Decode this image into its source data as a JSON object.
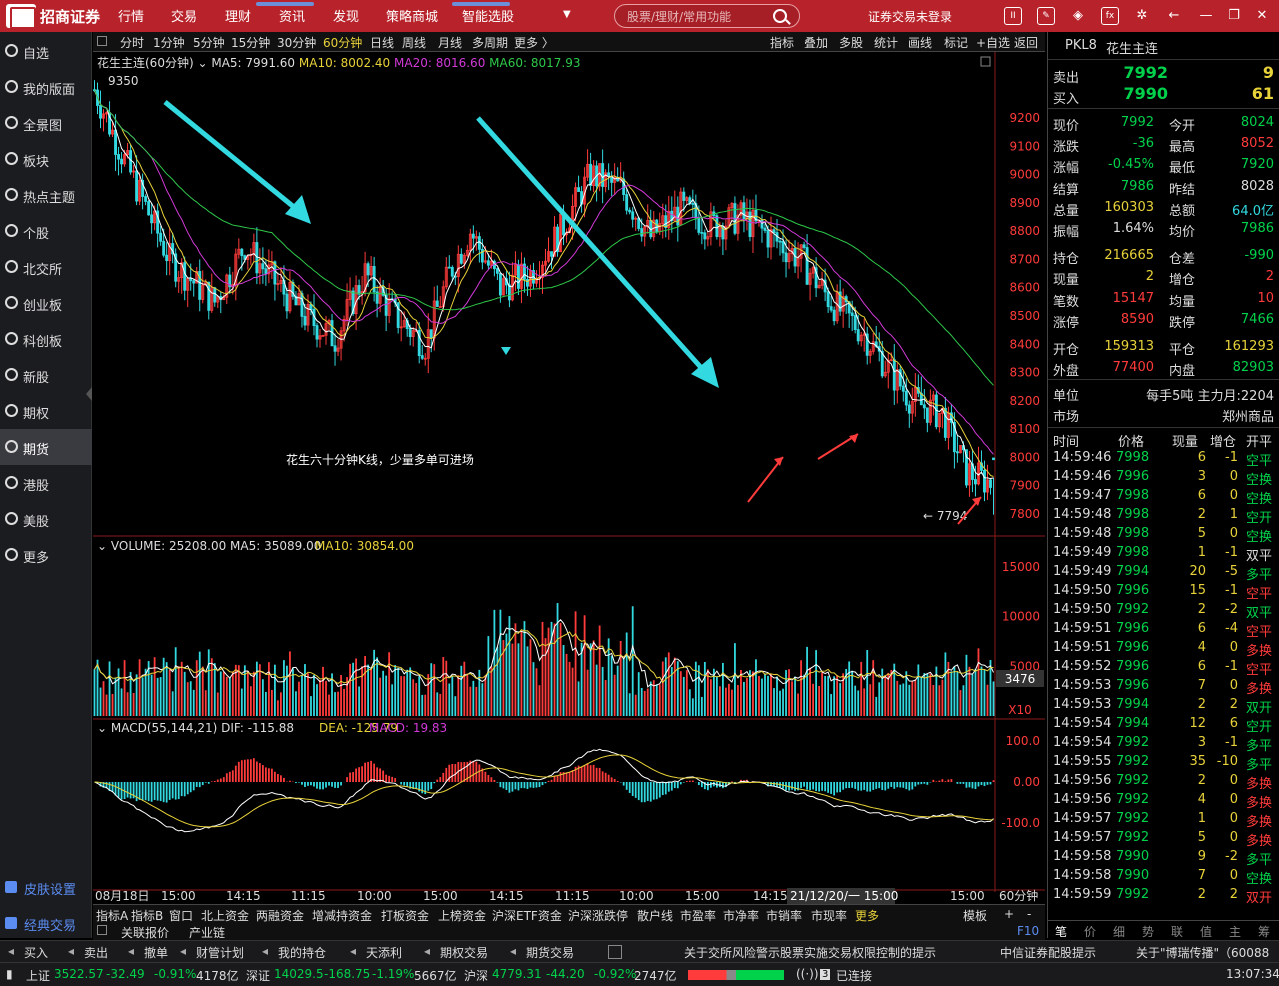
{
  "app": {
    "logo_text": "招商证券",
    "login_status": "证券交易未登录"
  },
  "topnav": [
    "行情",
    "交易",
    "理财",
    "资讯",
    "发现",
    "策略商城",
    "智能选股"
  ],
  "search": {
    "placeholder": "股票/理财/常用功能"
  },
  "top_icons": [
    "trade-icon",
    "edit-icon",
    "cube-icon",
    "fx-icon",
    "gear-icon",
    "back-icon",
    "window-restore-icon",
    "close-icon"
  ],
  "sidebar": [
    "自选",
    "我的版面",
    "全景图",
    "板块",
    "热点主题",
    "个股",
    "北交所",
    "创业板",
    "科创板",
    "新股",
    "期权",
    "期货",
    "港股",
    "美股",
    "更多"
  ],
  "sidebar_active": 11,
  "sidebar_bottom": [
    "皮肤设置",
    "经典交易"
  ],
  "periods": [
    "分时",
    "1分钟",
    "5分钟",
    "15分钟",
    "30分钟",
    "60分钟",
    "日线",
    "周线",
    "月线",
    "多周期",
    "更多 〉"
  ],
  "period_active": 5,
  "chart_tools": [
    "指标",
    "叠加",
    "多股",
    "统计",
    "画线",
    "标记",
    "+自选",
    "返回"
  ],
  "kline": {
    "name": "花生主连(60分钟)",
    "ma5": "MA5: 7991.60",
    "ma10": "MA10: 8002.40",
    "ma20": "MA20: 8016.60",
    "ma60": "MA60: 8017.93",
    "high_mark": "9350",
    "low_mark": "7794",
    "annotation": "花生六十分钟K线，少量多单可进场"
  },
  "volume": {
    "label": "VOLUME: 25208.00",
    "ma5": "MA5: 35089.00",
    "ma10": "MA10: 30854.00",
    "last": "3476",
    "unit": "X10",
    "ticks": [
      "15000",
      "10000",
      "5000"
    ]
  },
  "macd": {
    "label": "MACD(55,144,21)",
    "dif": "DIF: -115.88",
    "dea": "DEA: -125.79",
    "macd": "MACD: 19.83",
    "ticks": [
      "100.0",
      "0.00",
      "-100.0"
    ]
  },
  "time_axis": [
    "08月18日",
    "15:00",
    "14:15",
    "11:15",
    "10:00",
    "15:00",
    "14:15",
    "11:15",
    "10:00",
    "15:00",
    "14:15",
    "15:00",
    "15:00"
  ],
  "time_cursor": "21/12/20/一 15:00",
  "time_unit": "60分钟",
  "bottom_tabs": [
    "指标A",
    "指标B",
    "窗口",
    "北上资金",
    "两融资金",
    "增减持资金",
    "打板资金",
    "上榜资金",
    "沪深ETF资金",
    "沪深涨跌停",
    "散户线",
    "市盈率",
    "市净率",
    "市销率",
    "市现率",
    "更多"
  ],
  "bottom_tabs_right": [
    "模板",
    "+",
    "-"
  ],
  "bottom_tabs2": [
    "关联报价",
    "产业链"
  ],
  "bottom_f10": "F10",
  "chart_data": {
    "type": "candlestick",
    "title": "花生主连(60分钟)",
    "ylim": [
      7750,
      9350
    ],
    "yticks": [
      9200,
      9100,
      9000,
      8900,
      8800,
      8700,
      8600,
      8500,
      8400,
      8300,
      8200,
      8100,
      8000,
      7900,
      7800
    ],
    "high": 9350,
    "low": 7794,
    "last_volume": 3476
  },
  "quote": {
    "code": "PKL8",
    "name": "花生主连",
    "sell": {
      "label": "卖出",
      "price": "7992",
      "vol": "9"
    },
    "buy": {
      "label": "买入",
      "price": "7990",
      "vol": "61"
    },
    "rows": [
      [
        {
          "l": "现价",
          "v": "7992",
          "c": "dn"
        },
        {
          "l": "今开",
          "v": "8024",
          "c": "dn"
        }
      ],
      [
        {
          "l": "涨跌",
          "v": "-36",
          "c": "dn"
        },
        {
          "l": "最高",
          "v": "8052",
          "c": "up"
        }
      ],
      [
        {
          "l": "涨幅",
          "v": "-0.45%",
          "c": "dn"
        },
        {
          "l": "最低",
          "v": "7920",
          "c": "dn"
        }
      ],
      [
        {
          "l": "结算",
          "v": "7986",
          "c": "dn"
        },
        {
          "l": "昨结",
          "v": "8028",
          "c": "wt"
        }
      ],
      [
        {
          "l": "总量",
          "v": "160303",
          "c": "yl"
        },
        {
          "l": "总额",
          "v": "64.0亿",
          "c": "cy"
        }
      ],
      [
        {
          "l": "振幅",
          "v": "1.64%",
          "c": "wt"
        },
        {
          "l": "均价",
          "v": "7986",
          "c": "dn"
        }
      ],
      [
        {
          "l": "持仓",
          "v": "216665",
          "c": "yl"
        },
        {
          "l": "仓差",
          "v": "-990",
          "c": "dn"
        }
      ],
      [
        {
          "l": "现量",
          "v": "2",
          "c": "yl"
        },
        {
          "l": "增仓",
          "v": "2",
          "c": "up"
        }
      ],
      [
        {
          "l": "笔数",
          "v": "15147",
          "c": "up"
        },
        {
          "l": "均量",
          "v": "10",
          "c": "up"
        }
      ],
      [
        {
          "l": "涨停",
          "v": "8590",
          "c": "up"
        },
        {
          "l": "跌停",
          "v": "7466",
          "c": "dn"
        }
      ],
      [
        {
          "l": "开仓",
          "v": "159313",
          "c": "yl"
        },
        {
          "l": "平仓",
          "v": "161293",
          "c": "yl"
        }
      ],
      [
        {
          "l": "外盘",
          "v": "77400",
          "c": "up"
        },
        {
          "l": "内盘",
          "v": "82903",
          "c": "dn"
        }
      ]
    ],
    "unit_label": "单位",
    "unit_value": "每手5吨 主力月:2204",
    "market_label": "市场",
    "market_value": "郑州商品"
  },
  "ticks_header": [
    "时间",
    "价格",
    "现量",
    "增仓",
    "开平"
  ],
  "ticks": [
    [
      "14:59:46",
      "7998",
      "6",
      "-1",
      "空平",
      "dn",
      "dn"
    ],
    [
      "14:59:46",
      "7996",
      "3",
      "0",
      "空换",
      "dn",
      "dn"
    ],
    [
      "14:59:47",
      "7998",
      "6",
      "0",
      "空换",
      "dn",
      "dn"
    ],
    [
      "14:59:48",
      "7998",
      "2",
      "1",
      "空开",
      "dn",
      "dn"
    ],
    [
      "14:59:48",
      "7998",
      "5",
      "0",
      "空换",
      "dn",
      "dn"
    ],
    [
      "14:59:49",
      "7998",
      "1",
      "-1",
      "双平",
      "dn",
      "wt"
    ],
    [
      "14:59:49",
      "7994",
      "20",
      "-5",
      "多平",
      "dn",
      "dn"
    ],
    [
      "14:59:50",
      "7996",
      "15",
      "-1",
      "空平",
      "dn",
      "up"
    ],
    [
      "14:59:50",
      "7992",
      "2",
      "-2",
      "双平",
      "dn",
      "dn"
    ],
    [
      "14:59:51",
      "7996",
      "6",
      "-4",
      "空平",
      "dn",
      "up"
    ],
    [
      "14:59:51",
      "7996",
      "4",
      "0",
      "多换",
      "dn",
      "up"
    ],
    [
      "14:59:52",
      "7996",
      "6",
      "-1",
      "空平",
      "dn",
      "up"
    ],
    [
      "14:59:53",
      "7996",
      "7",
      "0",
      "多换",
      "dn",
      "up"
    ],
    [
      "14:59:53",
      "7994",
      "2",
      "2",
      "双开",
      "dn",
      "dn"
    ],
    [
      "14:59:54",
      "7994",
      "12",
      "6",
      "空开",
      "dn",
      "dn"
    ],
    [
      "14:59:54",
      "7992",
      "3",
      "-1",
      "多平",
      "dn",
      "dn"
    ],
    [
      "14:59:55",
      "7992",
      "35",
      "-10",
      "多平",
      "dn",
      "dn"
    ],
    [
      "14:59:56",
      "7992",
      "2",
      "0",
      "多换",
      "dn",
      "up"
    ],
    [
      "14:59:56",
      "7992",
      "4",
      "0",
      "多换",
      "dn",
      "up"
    ],
    [
      "14:59:57",
      "7992",
      "1",
      "0",
      "多换",
      "dn",
      "up"
    ],
    [
      "14:59:57",
      "7992",
      "5",
      "0",
      "多换",
      "dn",
      "up"
    ],
    [
      "14:59:58",
      "7990",
      "9",
      "-2",
      "多平",
      "dn",
      "dn"
    ],
    [
      "14:59:58",
      "7990",
      "7",
      "0",
      "空换",
      "dn",
      "dn"
    ],
    [
      "14:59:59",
      "7992",
      "2",
      "2",
      "双开",
      "dn",
      "up"
    ]
  ],
  "right_tabs": [
    "笔",
    "价",
    "细",
    "势",
    "联",
    "值",
    "主",
    "筹"
  ],
  "toolbar2": [
    "买入",
    "卖出",
    "撤单",
    "财管计划",
    "我的持仓",
    "天添利",
    "期权交易",
    "期货交易"
  ],
  "notice": "关于交所风险警示股票实施交易权限控制的提示",
  "notice2": "中信证券配股提示",
  "notice3": "关于\"博瑞传播\"（60088",
  "status": {
    "sh_name": "上证",
    "sh_val": "3522.57",
    "sh_chg": "-32.49",
    "sh_pct": "-0.91%",
    "sh_amt": "4178亿",
    "sz_name": "深证",
    "sz_val": "14029.5",
    "sz_chg": "-168.75",
    "sz_pct": "-1.19%",
    "sz_amt": "5667亿",
    "hs_name": "沪深",
    "hs_val": "4779.31",
    "hs_chg": "-44.20",
    "hs_pct": "-0.92%",
    "hs_amt": "2747亿",
    "conn": "已连接",
    "conn_n": "3",
    "clock": "13:07:34"
  }
}
